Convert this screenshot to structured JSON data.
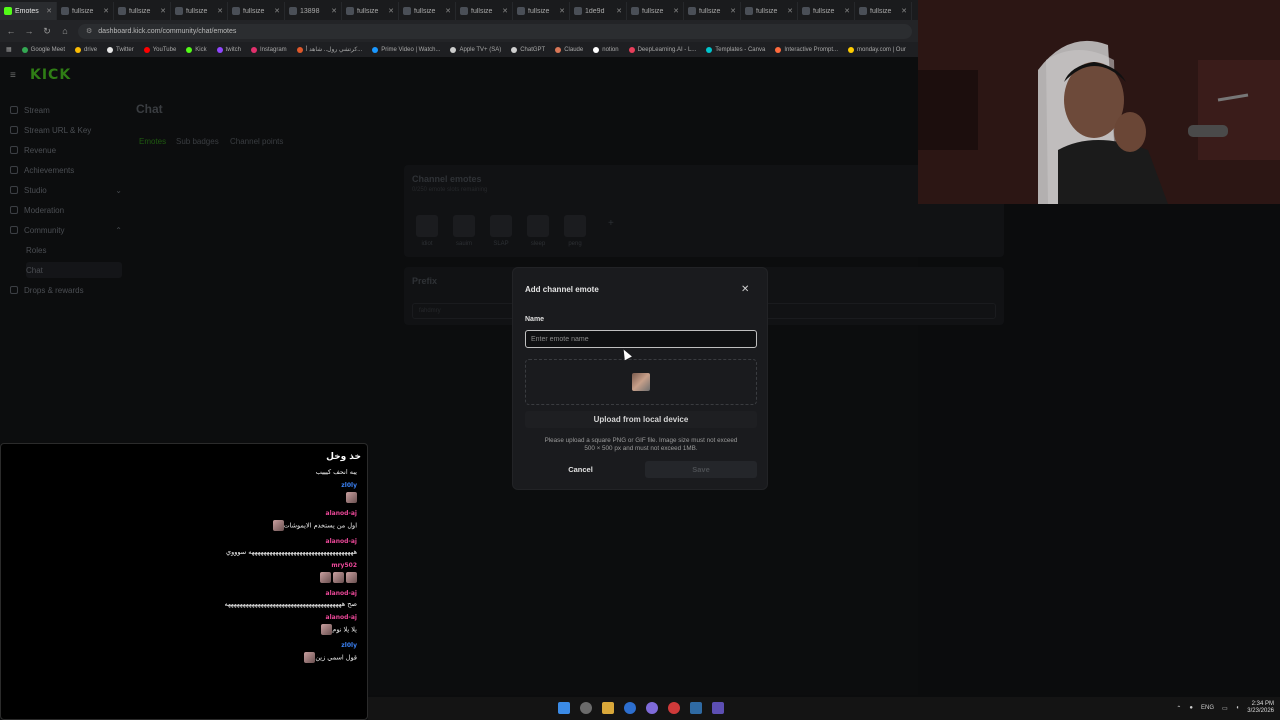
{
  "browser": {
    "tabs": [
      {
        "label": "Emotes",
        "active": true
      },
      {
        "label": "fullsize"
      },
      {
        "label": "fullsize"
      },
      {
        "label": "fullsize"
      },
      {
        "label": "fullsize"
      },
      {
        "label": "13898"
      },
      {
        "label": "fullsize"
      },
      {
        "label": "fullsize"
      },
      {
        "label": "fullsize"
      },
      {
        "label": "fullsize"
      },
      {
        "label": "1de9d"
      },
      {
        "label": "fullsize"
      },
      {
        "label": "fullsize"
      },
      {
        "label": "fullsize"
      },
      {
        "label": "fullsize"
      },
      {
        "label": "fullsize"
      }
    ],
    "url": "dashboard.kick.com/community/chat/emotes",
    "bookmarks": [
      {
        "label": "Google Meet",
        "color": "#34a853"
      },
      {
        "label": "drive",
        "color": "#fbbc04"
      },
      {
        "label": "Twitter",
        "color": "#e7e7e7"
      },
      {
        "label": "YouTube",
        "color": "#ff0000"
      },
      {
        "label": "Kick",
        "color": "#53fc18"
      },
      {
        "label": "twitch",
        "color": "#9146ff"
      },
      {
        "label": "Instagram",
        "color": "#e1306c"
      },
      {
        "label": "كرتشي رول.. شاهد أ...",
        "color": "#e0582a"
      },
      {
        "label": "Prime Video | Watch...",
        "color": "#1a98ff"
      },
      {
        "label": "Apple TV+ (SA)",
        "color": "#cccccc"
      },
      {
        "label": "ChatGPT",
        "color": "#cfcfcf"
      },
      {
        "label": "Claude",
        "color": "#d97757"
      },
      {
        "label": "notion",
        "color": "#ffffff"
      },
      {
        "label": "DeepLearning.AI - L...",
        "color": "#e83e5a"
      },
      {
        "label": "Templates - Canva",
        "color": "#00c4cc"
      },
      {
        "label": "Interactive Prompt...",
        "color": "#ff6b3d"
      },
      {
        "label": "monday.com | Our",
        "color": "#ffcc00"
      }
    ]
  },
  "sidebar": {
    "logo": "KICK",
    "items": [
      {
        "label": "Stream"
      },
      {
        "label": "Stream URL & Key"
      },
      {
        "label": "Revenue"
      },
      {
        "label": "Achievements"
      },
      {
        "label": "Studio"
      },
      {
        "label": "Moderation"
      },
      {
        "label": "Community"
      },
      {
        "label": "Roles"
      },
      {
        "label": "Chat"
      },
      {
        "label": "Drops & rewards"
      }
    ]
  },
  "main": {
    "title": "Chat",
    "tabs": [
      "Emotes",
      "Sub badges",
      "Channel points"
    ],
    "emotes_panel": {
      "title": "Channel emotes",
      "subtitle": "0/250 emote slots remaining",
      "emotes": [
        "idiot",
        "sauim",
        "SLAP",
        "sleep",
        "peng"
      ]
    },
    "prefix_panel": {
      "title": "Prefix",
      "value": "fahdmry"
    }
  },
  "modal": {
    "title": "Add channel emote",
    "name_label": "Name",
    "name_placeholder": "Enter emote name",
    "upload_label": "Upload from local device",
    "help_line1": "Please upload a square PNG or GIF file. Image size must not exceed",
    "help_line2": "500 × 500 px and must not exceed 1MB.",
    "cancel_label": "Cancel",
    "save_label": "Save"
  },
  "chat": {
    "header": "خذ وخل",
    "messages": [
      {
        "user": "",
        "text": "يبه انحف كيييب"
      },
      {
        "user": "zl0ly",
        "text": "",
        "color": "#3b82f6",
        "emotes": 1
      },
      {
        "user": "alanod-aj",
        "text": "اول من يستخدم الايموشات",
        "color": "#ec4899",
        "emotes": 1
      },
      {
        "user": "alanod-aj",
        "text": "هههههههههههههههههههههههههههههههههههه سوووي",
        "color": "#ec4899"
      },
      {
        "user": "mry502",
        "text": "",
        "color": "#ec4899",
        "emotes": 3
      },
      {
        "user": "alanod-aj",
        "text": "صح هههههههههههههههههههههههههههههههههههههههه",
        "color": "#ec4899"
      },
      {
        "user": "alanod-aj",
        "text": "يلا يلا نوم",
        "color": "#ec4899",
        "emotes": 1
      },
      {
        "user": "zl0ly",
        "text": "قول اسمي زين",
        "color": "#3b82f6",
        "emotes": 1
      }
    ]
  },
  "taskbar": {
    "lang": "ENG",
    "time": "2:34 PM",
    "date": "3/23/2026"
  }
}
